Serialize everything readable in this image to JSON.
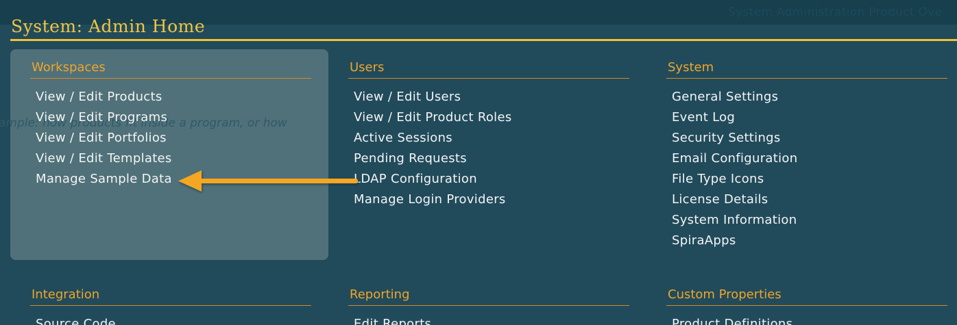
{
  "header": {
    "title": "System: Admin Home",
    "ghost_text": "System Administration   Product Ove"
  },
  "workspaces_description": "ample: how products fit inside a program, or how",
  "sections": [
    {
      "title": "Workspaces",
      "links": [
        "View / Edit Products",
        "View / Edit Programs",
        "View / Edit Portfolios",
        "View / Edit Templates",
        "Manage Sample Data"
      ]
    },
    {
      "title": "Users",
      "links": [
        "View / Edit Users",
        "View / Edit Product Roles",
        "Active Sessions",
        "Pending Requests",
        "LDAP Configuration",
        "Manage Login Providers"
      ]
    },
    {
      "title": "System",
      "links": [
        "General Settings",
        "Event Log",
        "Security Settings",
        "Email Configuration",
        "File Type Icons",
        "License Details",
        "System Information",
        "SpiraApps"
      ]
    },
    {
      "title": "Integration",
      "links": [
        "Source Code"
      ]
    },
    {
      "title": "Reporting",
      "links": [
        "Edit Reports"
      ]
    },
    {
      "title": "Custom Properties",
      "links": [
        "Product Definitions"
      ]
    }
  ],
  "annotation": {
    "icon": "arrow-left-icon",
    "color": "#f5a623"
  },
  "colors": {
    "background": "#214b5b",
    "accent_yellow": "#f1c232",
    "section_orange": "#f0a52a",
    "panel": "#507179"
  }
}
